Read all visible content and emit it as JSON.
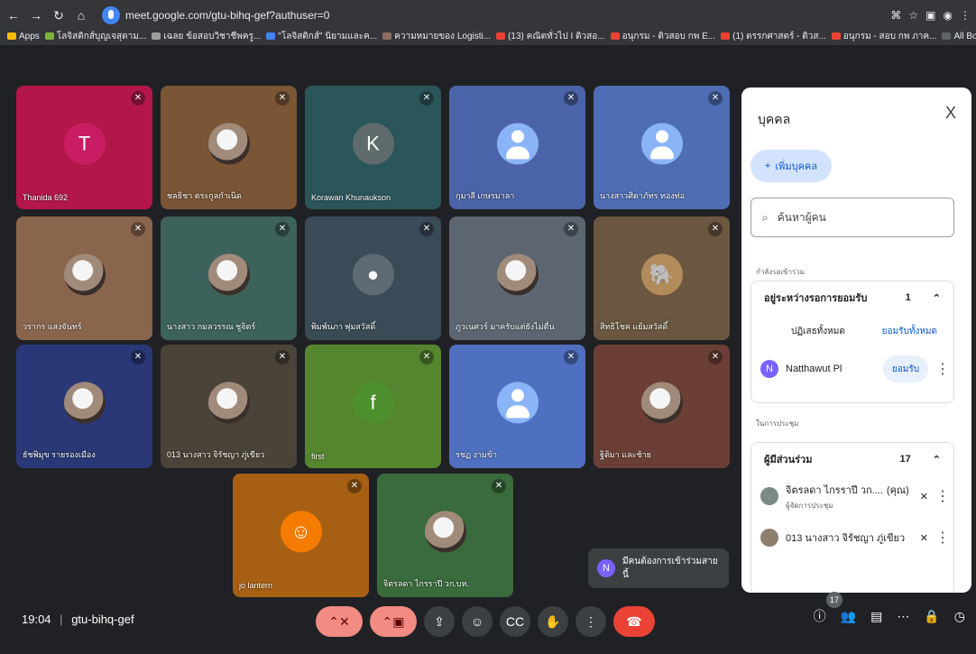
{
  "browser": {
    "url": "meet.google.com/gtu-bihq-gef?authuser=0",
    "bookmarks": [
      "Apps",
      "โลจิสติกส์บุญเจสุดาม...",
      "เฉลย ข้อสอบวิชาชีพครู...",
      "\"โลจิสติกส์\" นิยามและค...",
      "ความหมายของ Logisti...",
      "(13) คณิตทั่วไป I ติวสอ...",
      "อนุกรม - ติวสอบ กพ E...",
      "(1) ตรรกศาสตร์ - ติวส...",
      "อนุกรม - สอบ กพ ภาค...",
      "All Bookmarks"
    ]
  },
  "tiles": [
    {
      "name": "Thanida 692",
      "initial": "T",
      "bg": "#b3174a"
    },
    {
      "name": "ชลธิชา ตระกูลกำเนิด",
      "initial": "",
      "bg": "#7a5536"
    },
    {
      "name": "Korawan Khunaukson",
      "initial": "K",
      "bg": "#2b5659"
    },
    {
      "name": "กุมาลี เกษรมาลา",
      "initial": "",
      "bg": "#4b63a8"
    },
    {
      "name": "นางสาวศิตาภัทร ทองท่อ",
      "initial": "",
      "bg": "#4e6db4"
    },
    {
      "name": "วรากร แสงจันทร์",
      "initial": "",
      "bg": "#8a654d"
    },
    {
      "name": "นางสาว กมลวรรณ ชูจิตร์",
      "initial": "",
      "bg": "#3d615b"
    },
    {
      "name": "พิมพ์นภา พุ่มสวัสดิ์",
      "initial": "",
      "bg": "#394b57"
    },
    {
      "name": "ภูวเนศวร์ มาครับแต่ยังไม่ตื่น",
      "initial": "",
      "bg": "#5d6670"
    },
    {
      "name": "สิทธิโชค แย้มสวัสดิ์",
      "initial": "",
      "bg": "#6b573f"
    },
    {
      "name": "ธัชพิมุข รายรองเมือง",
      "initial": "",
      "bg": "#2a3877"
    },
    {
      "name": "013 นางสาว จิรัชญา ภู่เขียว",
      "initial": "",
      "bg": "#4a4338"
    },
    {
      "name": "first",
      "initial": "f",
      "bg": "#55862f"
    },
    {
      "name": "รชฏ งามข้า",
      "initial": "",
      "bg": "#4f6fc0"
    },
    {
      "name": "ฐิติมา และช้าย",
      "initial": "",
      "bg": "#6c3f36"
    },
    {
      "name": "jo lantern",
      "initial": "",
      "bg": "#a75f14"
    },
    {
      "name": "จิตรลดา ไกรราปี วก.บห.",
      "initial": "",
      "bg": "#3a6b3c"
    }
  ],
  "panel": {
    "title": "บุคคล",
    "close": "X",
    "add_people": "เพิ่มบุคคล",
    "search_placeholder": "ค้นหาผู้คน",
    "waiting_label": "กำลังรอเข้าร่วม",
    "waiting_group_title": "อยู่ระหว่างรอการยอมรับ",
    "waiting_count": "1",
    "reject_all": "ปฏิเสธทั้งหมด",
    "accept_all": "ยอมรับทั้งหมด",
    "waiting_person_name": "Natthawut Pl",
    "waiting_person_initial": "N",
    "admit": "ยอมรับ",
    "meeting_label": "ในการประชุม",
    "participants_title": "ผู้มีส่วนร่วม",
    "participants_count": "17",
    "participant_1_name": "จิตรลดา ไกรราปี วก....",
    "participant_1_tag": "(คุณ)",
    "participant_1_role": "ผู้จัดการประชุม",
    "participant_2_name": "013 นางสาว จิรัชญา ภู่เขียว"
  },
  "toast": {
    "initial": "N",
    "text": "มีคนต้องการเข้าร่วมสายนี้"
  },
  "bottom": {
    "time": "19:04",
    "meeting_code": "gtu-bihq-gef",
    "participants_badge": "17"
  }
}
